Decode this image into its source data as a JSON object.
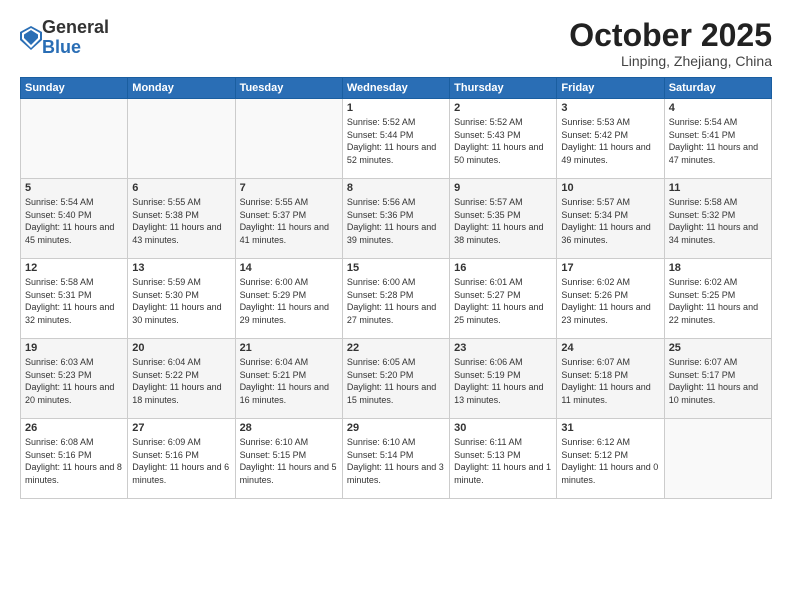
{
  "logo": {
    "general": "General",
    "blue": "Blue"
  },
  "title": "October 2025",
  "location": "Linping, Zhejiang, China",
  "days_of_week": [
    "Sunday",
    "Monday",
    "Tuesday",
    "Wednesday",
    "Thursday",
    "Friday",
    "Saturday"
  ],
  "weeks": [
    [
      {
        "day": "",
        "info": ""
      },
      {
        "day": "",
        "info": ""
      },
      {
        "day": "",
        "info": ""
      },
      {
        "day": "1",
        "info": "Sunrise: 5:52 AM\nSunset: 5:44 PM\nDaylight: 11 hours\nand 52 minutes."
      },
      {
        "day": "2",
        "info": "Sunrise: 5:52 AM\nSunset: 5:43 PM\nDaylight: 11 hours\nand 50 minutes."
      },
      {
        "day": "3",
        "info": "Sunrise: 5:53 AM\nSunset: 5:42 PM\nDaylight: 11 hours\nand 49 minutes."
      },
      {
        "day": "4",
        "info": "Sunrise: 5:54 AM\nSunset: 5:41 PM\nDaylight: 11 hours\nand 47 minutes."
      }
    ],
    [
      {
        "day": "5",
        "info": "Sunrise: 5:54 AM\nSunset: 5:40 PM\nDaylight: 11 hours\nand 45 minutes."
      },
      {
        "day": "6",
        "info": "Sunrise: 5:55 AM\nSunset: 5:38 PM\nDaylight: 11 hours\nand 43 minutes."
      },
      {
        "day": "7",
        "info": "Sunrise: 5:55 AM\nSunset: 5:37 PM\nDaylight: 11 hours\nand 41 minutes."
      },
      {
        "day": "8",
        "info": "Sunrise: 5:56 AM\nSunset: 5:36 PM\nDaylight: 11 hours\nand 39 minutes."
      },
      {
        "day": "9",
        "info": "Sunrise: 5:57 AM\nSunset: 5:35 PM\nDaylight: 11 hours\nand 38 minutes."
      },
      {
        "day": "10",
        "info": "Sunrise: 5:57 AM\nSunset: 5:34 PM\nDaylight: 11 hours\nand 36 minutes."
      },
      {
        "day": "11",
        "info": "Sunrise: 5:58 AM\nSunset: 5:32 PM\nDaylight: 11 hours\nand 34 minutes."
      }
    ],
    [
      {
        "day": "12",
        "info": "Sunrise: 5:58 AM\nSunset: 5:31 PM\nDaylight: 11 hours\nand 32 minutes."
      },
      {
        "day": "13",
        "info": "Sunrise: 5:59 AM\nSunset: 5:30 PM\nDaylight: 11 hours\nand 30 minutes."
      },
      {
        "day": "14",
        "info": "Sunrise: 6:00 AM\nSunset: 5:29 PM\nDaylight: 11 hours\nand 29 minutes."
      },
      {
        "day": "15",
        "info": "Sunrise: 6:00 AM\nSunset: 5:28 PM\nDaylight: 11 hours\nand 27 minutes."
      },
      {
        "day": "16",
        "info": "Sunrise: 6:01 AM\nSunset: 5:27 PM\nDaylight: 11 hours\nand 25 minutes."
      },
      {
        "day": "17",
        "info": "Sunrise: 6:02 AM\nSunset: 5:26 PM\nDaylight: 11 hours\nand 23 minutes."
      },
      {
        "day": "18",
        "info": "Sunrise: 6:02 AM\nSunset: 5:25 PM\nDaylight: 11 hours\nand 22 minutes."
      }
    ],
    [
      {
        "day": "19",
        "info": "Sunrise: 6:03 AM\nSunset: 5:23 PM\nDaylight: 11 hours\nand 20 minutes."
      },
      {
        "day": "20",
        "info": "Sunrise: 6:04 AM\nSunset: 5:22 PM\nDaylight: 11 hours\nand 18 minutes."
      },
      {
        "day": "21",
        "info": "Sunrise: 6:04 AM\nSunset: 5:21 PM\nDaylight: 11 hours\nand 16 minutes."
      },
      {
        "day": "22",
        "info": "Sunrise: 6:05 AM\nSunset: 5:20 PM\nDaylight: 11 hours\nand 15 minutes."
      },
      {
        "day": "23",
        "info": "Sunrise: 6:06 AM\nSunset: 5:19 PM\nDaylight: 11 hours\nand 13 minutes."
      },
      {
        "day": "24",
        "info": "Sunrise: 6:07 AM\nSunset: 5:18 PM\nDaylight: 11 hours\nand 11 minutes."
      },
      {
        "day": "25",
        "info": "Sunrise: 6:07 AM\nSunset: 5:17 PM\nDaylight: 11 hours\nand 10 minutes."
      }
    ],
    [
      {
        "day": "26",
        "info": "Sunrise: 6:08 AM\nSunset: 5:16 PM\nDaylight: 11 hours\nand 8 minutes."
      },
      {
        "day": "27",
        "info": "Sunrise: 6:09 AM\nSunset: 5:16 PM\nDaylight: 11 hours\nand 6 minutes."
      },
      {
        "day": "28",
        "info": "Sunrise: 6:10 AM\nSunset: 5:15 PM\nDaylight: 11 hours\nand 5 minutes."
      },
      {
        "day": "29",
        "info": "Sunrise: 6:10 AM\nSunset: 5:14 PM\nDaylight: 11 hours\nand 3 minutes."
      },
      {
        "day": "30",
        "info": "Sunrise: 6:11 AM\nSunset: 5:13 PM\nDaylight: 11 hours\nand 1 minute."
      },
      {
        "day": "31",
        "info": "Sunrise: 6:12 AM\nSunset: 5:12 PM\nDaylight: 11 hours\nand 0 minutes."
      },
      {
        "day": "",
        "info": ""
      }
    ]
  ]
}
